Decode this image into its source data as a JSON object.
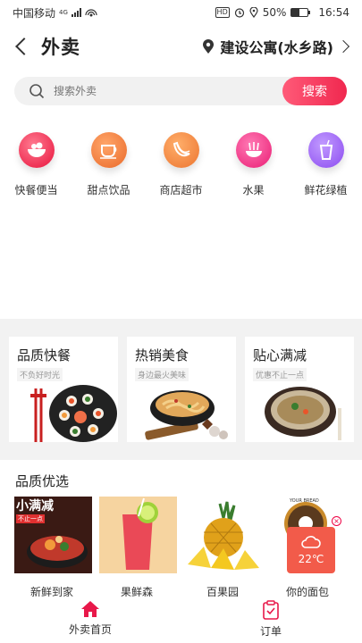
{
  "status_bar": {
    "carrier": "中国移动",
    "network": "4G",
    "battery": "50%",
    "time": "16:54",
    "hd": "HD"
  },
  "header": {
    "title": "外卖",
    "location": "建设公寓(水乡路)"
  },
  "search": {
    "placeholder": "搜索外卖",
    "button": "搜索"
  },
  "categories": [
    {
      "label": "快餐便当",
      "icon": "bowl-icon",
      "color": "#f0284f"
    },
    {
      "label": "甜点饮品",
      "icon": "cup-icon",
      "color": "#f07a3a"
    },
    {
      "label": "商店超市",
      "icon": "banana-icon",
      "color": "#f0893a"
    },
    {
      "label": "水果",
      "icon": "fruit-bowl-icon",
      "color": "#f53a8a"
    },
    {
      "label": "鲜花绿植",
      "icon": "drink-icon",
      "color": "#a26bf0"
    }
  ],
  "promos": [
    {
      "title": "品质快餐",
      "tag": "不负好时光"
    },
    {
      "title": "热销美食",
      "tag": "身边最火美味"
    },
    {
      "title": "贴心满减",
      "tag": "优惠不止一点"
    }
  ],
  "quality": {
    "title": "品质优选",
    "items": [
      {
        "label": "新鲜到家",
        "badge": "小满减",
        "sub": "不止一点"
      },
      {
        "label": "果鲜森"
      },
      {
        "label": "百果园"
      },
      {
        "label": "你的面包"
      }
    ]
  },
  "weather": {
    "temp": "22℃"
  },
  "tabs": [
    {
      "label": "外卖首页",
      "icon": "home-icon",
      "active": true
    },
    {
      "label": "订单",
      "icon": "order-icon",
      "active": false
    }
  ]
}
